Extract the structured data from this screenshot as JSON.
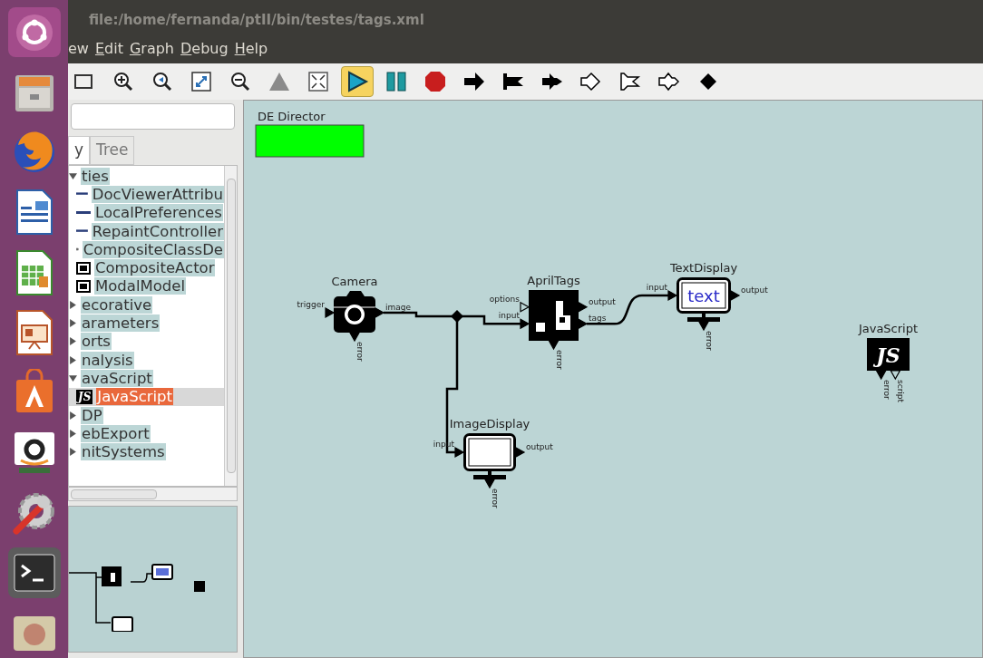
{
  "window": {
    "title": "file:/home/fernanda/ptII/bin/testes/tags.xml"
  },
  "menu": [
    {
      "label": "ew",
      "underline": false
    },
    {
      "label": "Edit",
      "underline": true
    },
    {
      "label": "Graph",
      "underline": true
    },
    {
      "label": "Debug",
      "underline": true
    },
    {
      "label": "Help",
      "underline": true
    }
  ],
  "toolbar": [
    {
      "kind": "save",
      "selected": false
    },
    {
      "kind": "zoom-in",
      "selected": false
    },
    {
      "kind": "zoom-reset",
      "selected": false
    },
    {
      "kind": "zoom-fit",
      "selected": false
    },
    {
      "kind": "zoom-out",
      "selected": false
    },
    {
      "kind": "triangle",
      "selected": false
    },
    {
      "kind": "fullscreen",
      "selected": false
    },
    {
      "kind": "run",
      "selected": true
    },
    {
      "kind": "pause",
      "selected": false
    },
    {
      "kind": "stop",
      "selected": false
    },
    {
      "kind": "arrow",
      "selected": false
    },
    {
      "kind": "flag",
      "selected": false
    },
    {
      "kind": "double",
      "selected": false
    },
    {
      "kind": "hollow-arrow",
      "selected": false
    },
    {
      "kind": "hollow-flag",
      "selected": false
    },
    {
      "kind": "hollow-double",
      "selected": false
    },
    {
      "kind": "diamond",
      "selected": false
    }
  ],
  "library": {
    "tabs": [
      {
        "label": "y",
        "selected": true
      },
      {
        "label": "Tree",
        "selected": false
      }
    ],
    "tree": [
      {
        "label": "ties",
        "expanded": true,
        "selected": false,
        "children": [
          {
            "label": "DocViewerAttribu",
            "kind": "attribute",
            "selected": false
          },
          {
            "label": "LocalPreferences",
            "kind": "attribute",
            "selected": false
          },
          {
            "label": "RepaintController",
            "kind": "attribute",
            "selected": false
          },
          {
            "label": "CompositeClassDe",
            "kind": "composite",
            "selected": false
          },
          {
            "label": "CompositeActor",
            "kind": "composite",
            "selected": false
          },
          {
            "label": "ModalModel",
            "kind": "composite",
            "selected": false
          }
        ]
      },
      {
        "label": "ecorative",
        "expanded": false,
        "selected": false
      },
      {
        "label": "arameters",
        "expanded": false,
        "selected": false
      },
      {
        "label": "orts",
        "expanded": false,
        "selected": false
      },
      {
        "label": "nalysis",
        "expanded": false,
        "selected": false
      },
      {
        "label": "avaScript",
        "expanded": true,
        "selected": false,
        "children": [
          {
            "label": "JavaScript",
            "kind": "js",
            "badge": "JS",
            "selected": true
          }
        ]
      },
      {
        "label": "DP",
        "expanded": false,
        "selected": false
      },
      {
        "label": "ebExport",
        "expanded": false,
        "selected": false
      },
      {
        "label": "nitSystems",
        "expanded": false,
        "selected": false
      }
    ]
  },
  "diagram": {
    "director": {
      "label": "DE Director",
      "color": "#00ff00"
    },
    "actors": [
      {
        "kind": "camera",
        "label": "Camera",
        "ports": [
          {
            "name": "trigger",
            "kind": "left",
            "hollow": false
          },
          {
            "name": "image",
            "kind": "right",
            "hollow": false
          },
          {
            "name": "error",
            "kind": "bottom",
            "hollow": false
          }
        ]
      },
      {
        "kind": "tags",
        "label": "AprilTags",
        "ports": [
          {
            "name": "options",
            "kind": "left",
            "hollow": true
          },
          {
            "name": "input",
            "kind": "left",
            "hollow": false
          },
          {
            "name": "output",
            "kind": "right",
            "hollow": false
          },
          {
            "name": "tags",
            "kind": "right",
            "hollow": false
          },
          {
            "name": "error",
            "kind": "bottom",
            "hollow": false
          }
        ]
      },
      {
        "kind": "display",
        "label": "TextDisplay",
        "screen_text": "text",
        "ports": [
          {
            "name": "input",
            "kind": "left",
            "hollow": false
          },
          {
            "name": "output",
            "kind": "right",
            "hollow": false
          },
          {
            "name": "error",
            "kind": "bottom",
            "hollow": false
          }
        ]
      },
      {
        "kind": "display",
        "label": "ImageDisplay",
        "ports": [
          {
            "name": "input",
            "kind": "left",
            "hollow": false
          },
          {
            "name": "output",
            "kind": "right",
            "hollow": false
          },
          {
            "name": "error",
            "kind": "bottom",
            "hollow": false
          }
        ]
      },
      {
        "kind": "js",
        "label": "JavaScript",
        "logo": "JS",
        "ports": [
          {
            "name": "error",
            "kind": "bottom",
            "hollow": false
          },
          {
            "name": "script",
            "kind": "bottom",
            "hollow": true
          }
        ]
      }
    ]
  }
}
